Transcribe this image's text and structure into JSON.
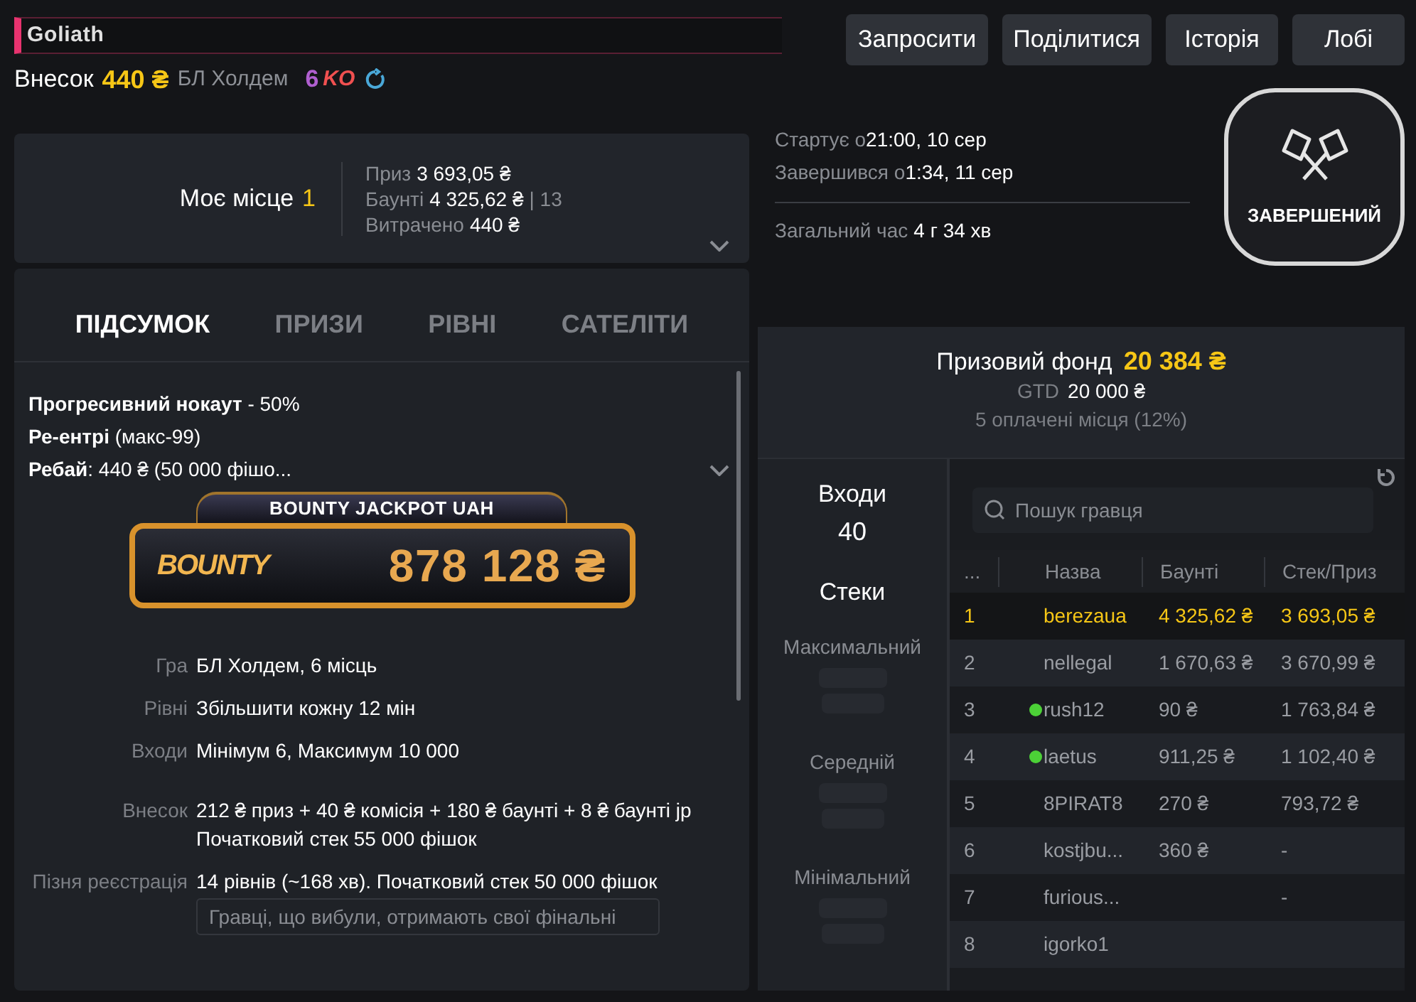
{
  "header": {
    "title": "Goliath",
    "buy_in_label": "Внесок",
    "buy_in": "440 ₴",
    "game": "БЛ Холдем",
    "seats": "6",
    "badge": "KO"
  },
  "actions": [
    "Запросити",
    "Поділитися",
    "Історія",
    "Лобі"
  ],
  "my_place": {
    "label": "Моє місце",
    "place": "1",
    "stats": [
      {
        "label": "Приз",
        "value": "3 693,05 ₴"
      },
      {
        "label": "Баунті",
        "value": "4 325,62 ₴",
        "extra": "| 13"
      },
      {
        "label": "Витрачено",
        "value": "440 ₴"
      }
    ]
  },
  "tabs": [
    {
      "label": "ПІДСУМОК",
      "selected": true
    },
    {
      "label": "ПРИЗИ",
      "selected": false
    },
    {
      "label": "РІВНІ",
      "selected": false
    },
    {
      "label": "САТЕЛІТИ",
      "selected": false
    }
  ],
  "features": [
    "**Прогресивний нокаут** - 50%",
    "**Ре-ентрі** (макс-99)",
    "**Ребай**: 440 ₴ (50 000 фішо..."
  ],
  "jackpot": {
    "title": "BOUNTY JACKPOT UAH",
    "logo": "BOUNTY",
    "amount": "878 128 ₴"
  },
  "details": [
    [
      {
        "label": "Гра",
        "lines": [
          "БЛ Холдем, 6 місць"
        ]
      },
      {
        "label": "Рівні",
        "lines": [
          "Збільшити кожну 12 мін"
        ]
      },
      {
        "label": "Входи",
        "lines": [
          "Мінімум 6, Максимум 10 000"
        ]
      }
    ],
    [
      {
        "label": "Внесок",
        "lines": [
          "212 ₴ приз + 40 ₴ комісія + 180 ₴ баунті + 8 ₴ баунті jp",
          "Початковий стек 55 000 фішок"
        ]
      },
      {
        "label": "Пізня реєстрація",
        "lines": [
          "14 рівнів (~168 хв). Початковий стек 50 000 фішок"
        ],
        "note": "Гравці, що вибули, отримають свої фінальні"
      }
    ]
  ],
  "schedule": [
    {
      "label": "Стартує о",
      "value": "21:00, 10 сер"
    },
    {
      "label": "Завершився о",
      "value": "1:34, 11 сер"
    }
  ],
  "total": {
    "label": "Загальний час",
    "value": "4 г 34 хв"
  },
  "status": "ЗАВЕРШЕНИЙ",
  "prize_pool": {
    "label": "Призовий фонд",
    "amount": "20 384 ₴",
    "gtd_label": "GTD",
    "gtd": "20 000 ₴",
    "paid": "5 оплачені місця (12%)"
  },
  "entries": {
    "label": "Входи",
    "value": "40"
  },
  "stacks": {
    "title": "Стеки",
    "items": [
      "Максимальний",
      "Середній",
      "Мінімальний"
    ]
  },
  "search": {
    "placeholder": "Пошук гравця"
  },
  "table": {
    "columns": [
      "...",
      "Назва",
      "Баунті",
      "Стек/Приз"
    ],
    "rows": [
      {
        "cells": [
          "1",
          "berezaua",
          "4 325,62 ₴",
          "3 693,05 ₴"
        ],
        "selected": true,
        "online": false
      },
      {
        "cells": [
          "2",
          "nellegal",
          "1 670,63 ₴",
          "3 670,99 ₴"
        ],
        "selected": false,
        "online": false
      },
      {
        "cells": [
          "3",
          "rush12",
          "90 ₴",
          "1 763,84 ₴"
        ],
        "selected": false,
        "online": true
      },
      {
        "cells": [
          "4",
          "laetus",
          "911,25 ₴",
          "1 102,40 ₴"
        ],
        "selected": false,
        "online": true
      },
      {
        "cells": [
          "5",
          "8PIRAT8",
          "270 ₴",
          "793,72 ₴"
        ],
        "selected": false,
        "online": false
      },
      {
        "cells": [
          "6",
          "kostjbu...",
          "360 ₴",
          "-"
        ],
        "selected": false,
        "online": false
      },
      {
        "cells": [
          "7",
          "furious...",
          null,
          "-"
        ],
        "selected": false,
        "online": false
      },
      {
        "cells": [
          "8",
          "igorko1",
          null,
          null
        ],
        "selected": false,
        "online": false
      }
    ]
  }
}
